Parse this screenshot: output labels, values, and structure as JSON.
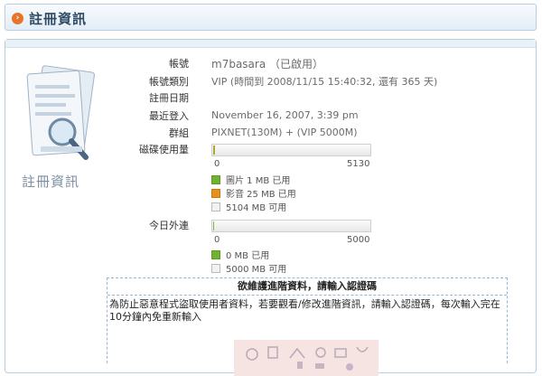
{
  "header": {
    "title": "註冊資訊",
    "icon": "orange-arrow-icon"
  },
  "sidebar": {
    "label": "註冊資訊",
    "icon": "document-magnifier-icon"
  },
  "fields": {
    "account": {
      "label": "帳號",
      "value": "m7basara （已啟用）"
    },
    "type": {
      "label": "帳號類別",
      "value": "VIP (時間到 2008/11/15 15:40:32, 還有 365 天)"
    },
    "registered": {
      "label": "註冊日期",
      "value": ""
    },
    "last_login": {
      "label": "最近登入",
      "value": "November 16, 2007, 3:39 pm"
    },
    "group": {
      "label": "群組",
      "value": "PIXNET(130M) + (VIP 5000M)"
    }
  },
  "disk": {
    "label": "磁碟使用量",
    "tick_min": "0",
    "tick_max": "5130",
    "total": 5130,
    "photo_used": 1,
    "media_used": 25,
    "legend_photo": "圖片 1 MB 已用",
    "legend_media": "影音 25 MB 已用",
    "legend_free": "5104 MB 可用"
  },
  "traffic": {
    "label": "今日外連",
    "tick_min": "0",
    "tick_max": "5000",
    "total": 5000,
    "used": 0,
    "legend_used": "0 MB 已用",
    "legend_free": "5000 MB 可用"
  },
  "verify": {
    "heading": "欲維護進階資料，請輸入認證碼",
    "text": "為防止惡意程式盜取使用者資料，若要觀看/修改進階資訊，請輸入認證碼，每次輸入完在10分鐘內免重新輸入"
  },
  "colors": {
    "accent": "#e8742a",
    "photo": "#6fb32e",
    "media": "#e8901c",
    "border": "#b7cde0"
  }
}
